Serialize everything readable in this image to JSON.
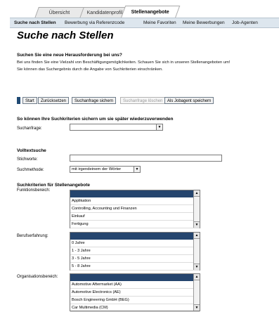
{
  "tabs": [
    "Übersicht",
    "Kandidatenprofil",
    "Stellenangebote"
  ],
  "subnav": [
    "Suche nach Stellen",
    "Bewerbung via Referenzcode",
    "Meine Favoriten",
    "Meine Bewerbungen",
    "Job-Agenten"
  ],
  "page_title": "Suche nach Stellen",
  "intro": {
    "heading": "Suchen Sie eine neue Herausforderung bei uns?",
    "line1": "Bei uns finden Sie eine Vielzahl von Beschäftigungsmöglichkeiten. Schauen Sie sich in unseren Stellenangeboten um!",
    "line2": "Sie können das Suchergebnis durch die Angabe von Suchkriterien einschränken."
  },
  "buttons": {
    "start": "Start",
    "reset": "Zurücksetzen",
    "save_query": "Suchanfrage sichern",
    "delete_query": "Suchanfrage löschen",
    "save_agent": "Als Jobagent speichern"
  },
  "saved": {
    "heading": "So können Ihre Suchkriterien sichern um sie später wiederzuverwenden",
    "query_label": "Suchanfrage:",
    "query_value": ""
  },
  "fulltext": {
    "heading": "Volltextsuche",
    "keywords_label": "Stichworte:",
    "keywords_value": "",
    "method_label": "Suchmethode:",
    "method_value": "mit irgendeinem der Wörter"
  },
  "criteria": {
    "heading": "Suchkriterien für Stellenangebote",
    "function_label": "Funktionsbereich:",
    "function_options": [
      "Applikation",
      "Controlling, Accounting und Finanzen",
      "Einkauf",
      "Fertigung"
    ],
    "experience_label": "Berufserfahrung:",
    "experience_options": [
      "0 Jahre",
      "1 - 3 Jahre",
      "3 - 5 Jahre",
      "5 - 8 Jahre"
    ],
    "org_label": "Organisationsbereich:",
    "org_options": [
      "Automotive Aftermarket (AA)",
      "Automotive Electronics (AE)",
      "Bosch Engineering GmbH (BEG)",
      "Car Multimedia (CM)"
    ]
  },
  "icons": {
    "dropdown_arrow": "▼",
    "scroll_up": "▲",
    "scroll_down": "▼"
  }
}
